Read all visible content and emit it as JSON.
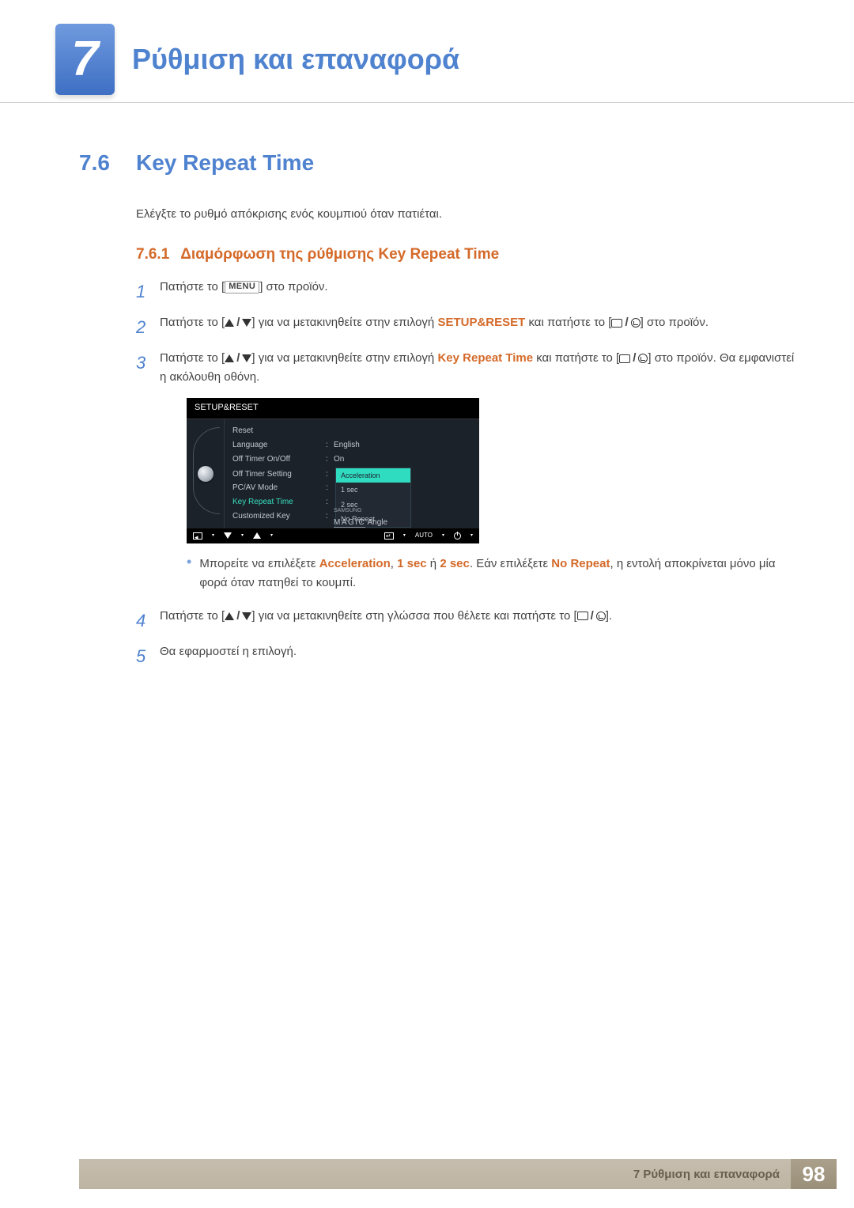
{
  "chapter": {
    "number": "7",
    "title": "Ρύθμιση και επαναφορά"
  },
  "section": {
    "number": "7.6",
    "title": "Key Repeat Time",
    "description": "Ελέγξτε το ρυθμό απόκρισης ενός κουμπιού όταν πατιέται."
  },
  "subsection": {
    "number": "7.6.1",
    "title": "Διαμόρφωση της ρύθμισης Key Repeat Time"
  },
  "steps": {
    "s1_a": "Πατήστε το [",
    "s1_b": "] στο προϊόν.",
    "s2_a": "Πατήστε το [",
    "s2_b": "] για να μετακινηθείτε στην επιλογή ",
    "s2_c": " και πατήστε το [",
    "s2_d": "] στο προϊόν.",
    "s2_hl": "SETUP&RESET",
    "s3_a": "Πατήστε το [",
    "s3_b": "] για να μετακινηθείτε στην επιλογή ",
    "s3_c": " και πατήστε το [",
    "s3_d": "] στο προϊόν. Θα εμφανιστεί η ακόλουθη οθόνη.",
    "s3_hl": "Key Repeat Time",
    "s4_a": "Πατήστε το [",
    "s4_b": "] για να μετακινηθείτε στη γλώσσα που θέλετε και πατήστε το [",
    "s4_c": "].",
    "s5": "Θα εφαρμοστεί η επιλογή."
  },
  "menu_btn": "MENU",
  "bullet": {
    "a": "Μπορείτε να επιλέξετε ",
    "opt1": "Acceleration",
    "sep1": ", ",
    "opt2": "1 sec",
    "or": " ή ",
    "opt3": "2 sec",
    "b": ". Εάν επιλέξετε ",
    "opt4": "No Repeat",
    "c": ", η εντολή αποκρίνεται μόνο μία φορά όταν πατηθεί το κουμπί."
  },
  "osd": {
    "title": "SETUP&RESET",
    "rows": [
      {
        "label": "Reset",
        "value": ""
      },
      {
        "label": "Language",
        "value": "English"
      },
      {
        "label": "Off Timer On/Off",
        "value": "On"
      },
      {
        "label": "Off Timer Setting",
        "value": ""
      },
      {
        "label": "PC/AV Mode",
        "value": ""
      },
      {
        "label": "Key Repeat Time",
        "value": ""
      },
      {
        "label": "Customized Key",
        "value": ""
      }
    ],
    "dropdown": [
      "Acceleration",
      "1 sec",
      "2 sec",
      "No Repeat"
    ],
    "magic_small": "SAMSUNG",
    "magic": "MAGIC",
    "magic_suffix": " Angle",
    "auto": "AUTO"
  },
  "footer": {
    "text": "7 Ρύθμιση και επαναφορά",
    "page": "98"
  }
}
